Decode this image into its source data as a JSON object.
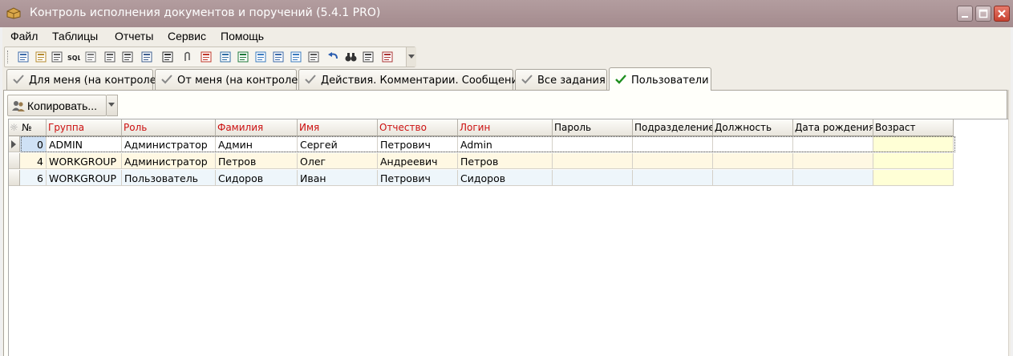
{
  "window": {
    "title": "Контроль исполнения документов и поручений (5.4.1 PRO)"
  },
  "menu": [
    "Файл",
    "Таблицы",
    "Отчеты",
    "Сервис",
    "Помощь"
  ],
  "toolbar_icons": [
    "new-record-icon",
    "edit-document-icon",
    "table-icon",
    "sql-icon",
    "filter-icon",
    "print-icon",
    "split-icon",
    "form-icon",
    "export-icon",
    "attach-icon",
    "flag-icon",
    "calendar-icon",
    "excel-icon",
    "html-icon",
    "clipboard-icon",
    "html-export-icon",
    "preview-icon",
    "undo-icon",
    "binoculars-icon",
    "card-icon",
    "chart-icon"
  ],
  "tabs": [
    {
      "label": "Для меня (на контроле)",
      "active": false
    },
    {
      "label": "От меня (на контроле)",
      "active": false
    },
    {
      "label": "Действия. Комментарии. Сообщения",
      "active": false
    },
    {
      "label": "Все задания",
      "active": false
    },
    {
      "label": "Пользователи",
      "active": true
    }
  ],
  "actions": {
    "copy_label": "Копировать..."
  },
  "grid": {
    "indicator_header": "☼",
    "columns": [
      {
        "key": "no",
        "label": "№",
        "required": false
      },
      {
        "key": "group",
        "label": "Группа",
        "required": true
      },
      {
        "key": "role",
        "label": "Роль",
        "required": true
      },
      {
        "key": "last",
        "label": "Фамилия",
        "required": true
      },
      {
        "key": "first",
        "label": "Имя",
        "required": true
      },
      {
        "key": "middle",
        "label": "Отчество",
        "required": true
      },
      {
        "key": "login",
        "label": "Логин",
        "required": true
      },
      {
        "key": "password",
        "label": "Пароль",
        "required": false
      },
      {
        "key": "dept",
        "label": "Подразделение",
        "required": false
      },
      {
        "key": "position",
        "label": "Должность",
        "required": false
      },
      {
        "key": "birth",
        "label": "Дата рождения",
        "required": false
      },
      {
        "key": "age",
        "label": "Возраст",
        "required": false
      }
    ],
    "rows": [
      {
        "no": "0",
        "group": "ADMIN",
        "role": "Администратор",
        "last": "Админ",
        "first": "Сергей",
        "middle": "Петрович",
        "login": "Admin",
        "password": "",
        "dept": "",
        "position": "",
        "birth": "",
        "age": ""
      },
      {
        "no": "4",
        "group": "WORKGROUP",
        "role": "Администратор",
        "last": "Петров",
        "first": "Олег",
        "middle": "Андреевич",
        "login": "Петров",
        "password": "",
        "dept": "",
        "position": "",
        "birth": "",
        "age": ""
      },
      {
        "no": "6",
        "group": "WORKGROUP",
        "role": "Пользователь",
        "last": "Сидоров",
        "first": "Иван",
        "middle": "Петрович",
        "login": "Сидоров",
        "password": "",
        "dept": "",
        "position": "",
        "birth": "",
        "age": ""
      }
    ],
    "selected_row": 0
  },
  "colors": {
    "required_header": "#cc1010",
    "titlebar": "#a9949a",
    "tab_check": "#1f8f1f"
  }
}
